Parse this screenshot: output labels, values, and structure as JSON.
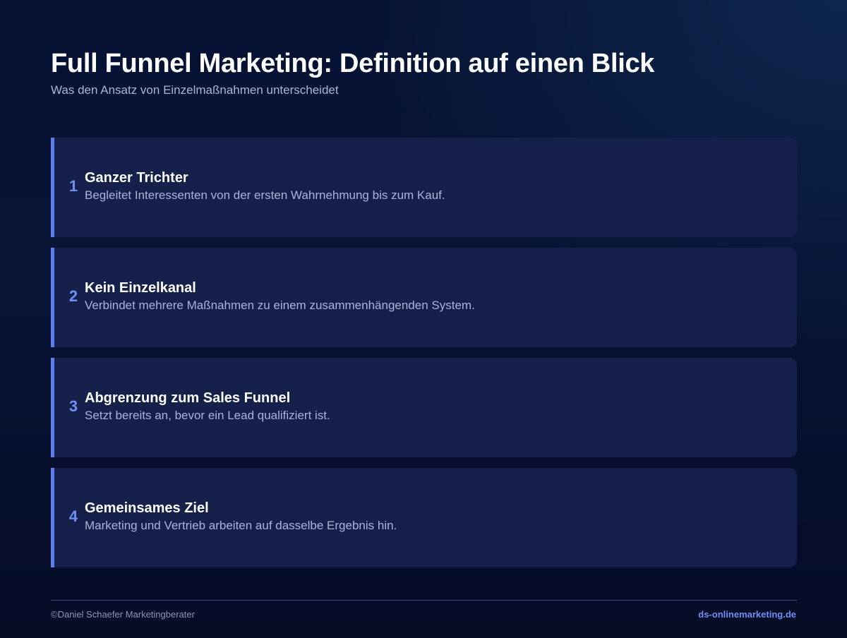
{
  "header": {
    "title": "Full Funnel Marketing: Definition auf einen Blick",
    "subtitle": "Was den Ansatz von Einzelmaßnahmen unterscheidet"
  },
  "items": [
    {
      "number": "1",
      "title": "Ganzer Trichter",
      "text": "Begleitet Interessenten von der ersten Wahrnehmung bis zum Kauf."
    },
    {
      "number": "2",
      "title": "Kein Einzelkanal",
      "text": "Verbindet mehrere Maßnahmen zu einem zusammenhängenden System."
    },
    {
      "number": "3",
      "title": "Abgrenzung zum Sales Funnel",
      "text": "Setzt bereits an, bevor ein Lead qualifiziert ist."
    },
    {
      "number": "4",
      "title": "Gemeinsames Ziel",
      "text": "Marketing und Vertrieb arbeiten auf dasselbe Ergebnis hin."
    }
  ],
  "footer": {
    "copyright": "©Daniel Schaefer Marketingberater",
    "site": "ds-onlinemarketing.de"
  },
  "colors": {
    "accent": "#5b7df0",
    "background": "#061233",
    "card_background": "#15214a"
  }
}
